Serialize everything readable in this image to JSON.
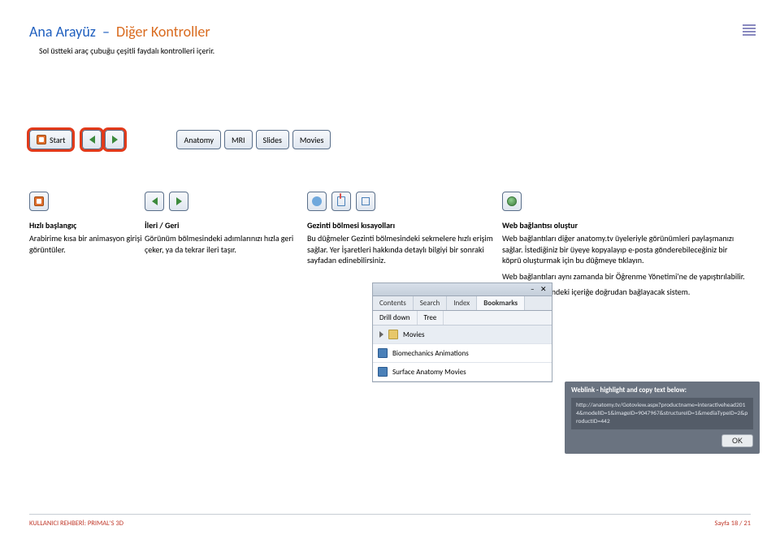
{
  "header": {
    "title_part1": "Ana Arayüz",
    "dash": "–",
    "title_part2": "Diğer Kontroller",
    "intro": "Sol üstteki araç çubuğu çeşitli faydalı kontrolleri içerir."
  },
  "toolbar": {
    "start_label": "Start",
    "tabs": [
      "Anatomy",
      "MRI",
      "Slides",
      "Movies"
    ]
  },
  "columns": {
    "c1": {
      "heading": "Hızlı başlangıç",
      "body": "Arabirime kısa bir animasyon girişi görüntüler."
    },
    "c2": {
      "heading": "İleri / Geri",
      "body": "Görünüm bölmesindeki adımlarınızı hızla geri çeker, ya da tekrar ileri taşır."
    },
    "c3": {
      "heading": "Gezinti bölmesi kısayolları",
      "body": "Bu düğmeler Gezinti bölmesindeki sekmelere hızlı erişim sağlar. Yer İşaretleri hakkında detaylı bilgiyi bir sonraki sayfadan edinebilirsiniz."
    },
    "c4": {
      "heading": "Web bağlantısı oluştur",
      "body1": "Web bağlantıları diğer anatomy.tv üyeleriyle görünümleri paylaşmanızı sağlar. İstediğiniz bir üyeye kopyalayıp e-posta gönderebileceğiniz bir köprü oluşturmak için bu düğmeye tıklayın.",
      "body2": "Web bağlantıları aynı zamanda bir Öğrenme Yönetimi'ne de yapıştırılabilir.",
      "body3": "Öğrencileri üründeki içeriğe doğrudan bağlayacak sistem."
    }
  },
  "bookmarks": {
    "tabs": {
      "contents": "Contents",
      "search": "Search",
      "index": "Index",
      "bookmarks": "Bookmarks"
    },
    "sub": {
      "drilldown": "Drill down",
      "tree": "Tree"
    },
    "items": {
      "movies": "Movies",
      "bio": "Biomechanics Animations",
      "surface": "Surface Anatomy Movies"
    }
  },
  "weblink": {
    "title": "Weblink - highlight and copy text below:",
    "url": "http://anatomy.tv/Gotoview.aspx?productname=interactivehead2014&modelID=1&imageID=9047967&structureID=1&mediaTypeID=2&productID=442",
    "ok": "OK"
  },
  "footer": {
    "left": "KULLANICI REHBERİ: PRIMAL'S 3D",
    "right": "Sayfa 18 / 21"
  }
}
